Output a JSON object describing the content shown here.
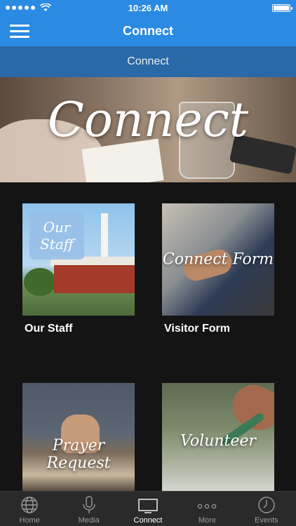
{
  "status_bar": {
    "time": "10:26 AM",
    "battery_level": 1.0
  },
  "nav": {
    "title": "Connect",
    "menu_icon": "hamburger-menu-icon"
  },
  "sub_header": {
    "title": "Connect"
  },
  "hero": {
    "overlay_text": "Connect"
  },
  "cards": [
    {
      "label": "Our Staff",
      "overlay": "",
      "badge": [
        "Our",
        "Staff"
      ]
    },
    {
      "label": "Visitor Form",
      "overlay": "Connect Form"
    },
    {
      "label": "",
      "overlay": "Prayer Request"
    },
    {
      "label": "",
      "overlay": "Volunteer"
    }
  ],
  "tabs": [
    {
      "label": "Home",
      "icon": "globe-icon",
      "active": false
    },
    {
      "label": "Media",
      "icon": "microphone-icon",
      "active": false
    },
    {
      "label": "Connect",
      "icon": "tv-icon",
      "active": true
    },
    {
      "label": "More",
      "icon": "more-dots-icon",
      "active": false
    },
    {
      "label": "Events",
      "icon": "clock-icon",
      "active": false
    }
  ],
  "colors": {
    "nav_blue": "#2b8ae2",
    "sub_header_blue": "#2a69a8",
    "tab_bar": "#2a2a2a",
    "background": "#141414"
  }
}
